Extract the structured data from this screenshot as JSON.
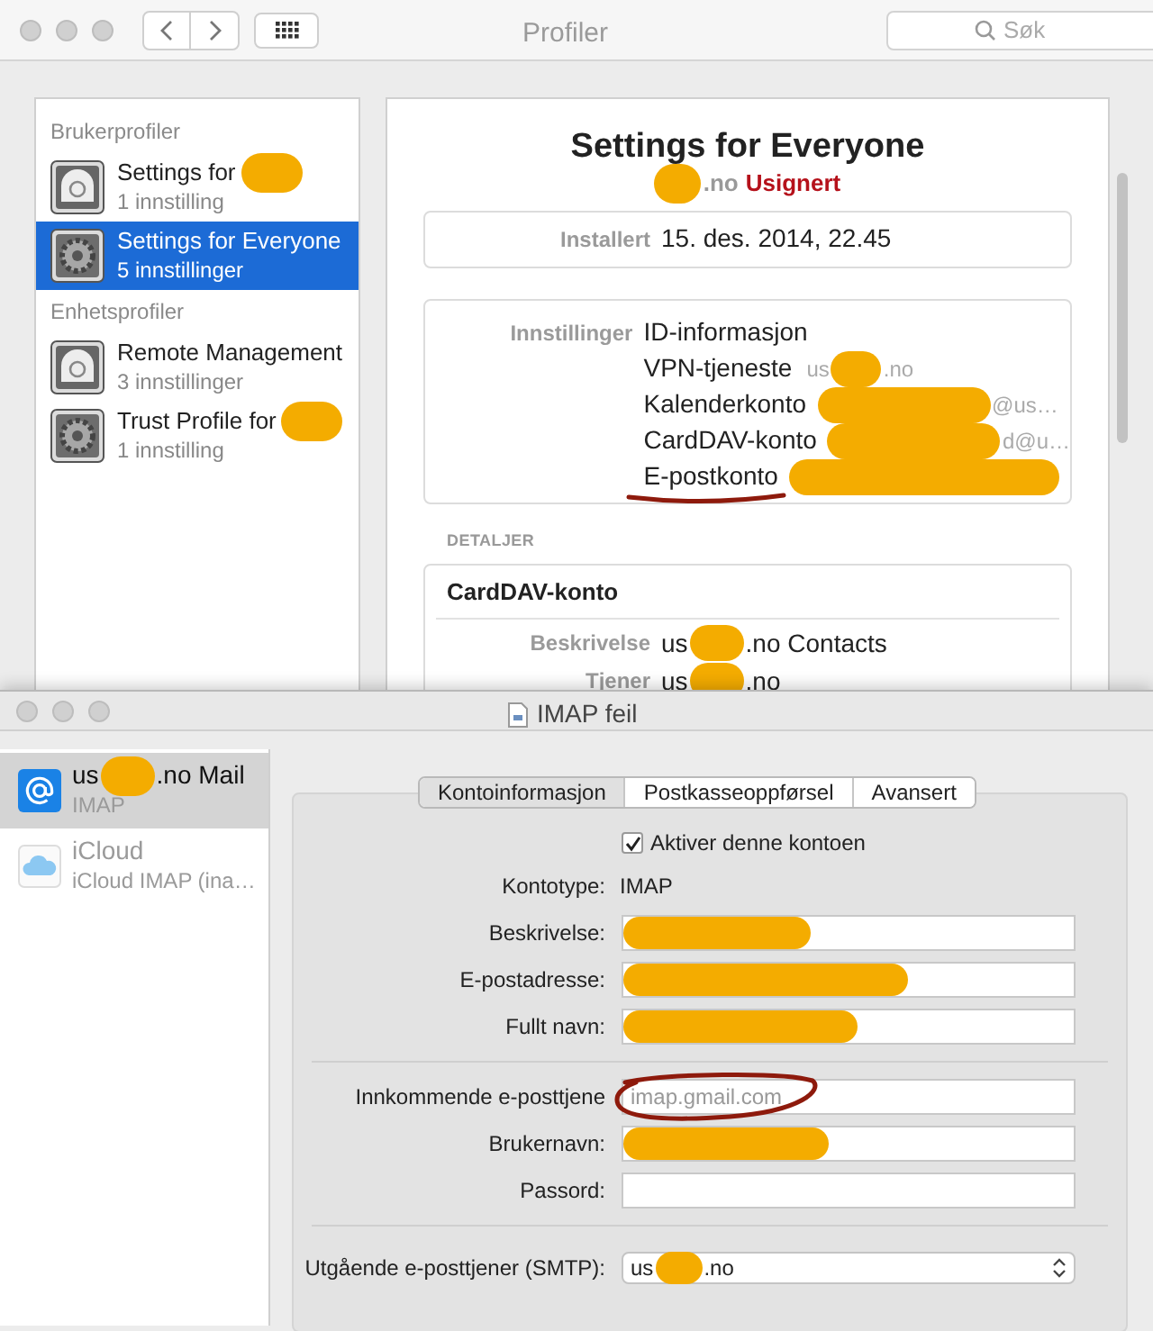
{
  "profiles_window": {
    "title": "Profiler",
    "search": {
      "placeholder": "Søk"
    },
    "sidebar": {
      "sections": [
        {
          "header": "Brukerprofiler",
          "items": [
            {
              "name": "Settings for",
              "redacted": true,
              "count": "1 innstilling",
              "selected": false,
              "kind": "badge"
            },
            {
              "name": "Settings for Everyone",
              "redacted": false,
              "count": "5 innstillinger",
              "selected": true,
              "kind": "gear"
            }
          ]
        },
        {
          "header": "Enhetsprofiler",
          "items": [
            {
              "name": "Remote Management",
              "redacted": false,
              "count": "3 innstillinger",
              "selected": false,
              "kind": "badge"
            },
            {
              "name": "Trust Profile for",
              "redacted": true,
              "count": "1 innstilling",
              "selected": false,
              "kind": "gear"
            }
          ]
        }
      ]
    },
    "detail": {
      "title": "Settings for Everyone",
      "org_after": ".no",
      "status": "Usignert",
      "installed": {
        "label": "Installert",
        "value": "15. des. 2014, 22.45"
      },
      "settings": {
        "label": "Innstillinger",
        "entries": [
          {
            "name": "ID-informasjon",
            "redacted": false,
            "marked": false
          },
          {
            "name": "VPN-tjeneste",
            "detail_before": "us",
            "detail_after": ".no",
            "redacted": true,
            "marked": false
          },
          {
            "name": "Kalenderkonto",
            "detail_after": "@us…",
            "redacted": true,
            "marked": false
          },
          {
            "name": "CardDAV-konto",
            "detail_after": "d@u…",
            "redacted": true,
            "marked": false
          },
          {
            "name": "E-postkonto",
            "redacted": true,
            "marked": true
          }
        ]
      },
      "details_header": "DETALJER",
      "card": {
        "title": "CardDAV-konto",
        "rows": [
          {
            "label": "Beskrivelse",
            "before": "us",
            "after": ".no Contacts"
          },
          {
            "label": "Tjener",
            "before": "us",
            "after": ".no"
          }
        ]
      }
    }
  },
  "mail_window": {
    "title": "IMAP feil",
    "accounts": [
      {
        "kind": "mail",
        "before": "us",
        "after": ".no Mail",
        "type": "IMAP",
        "selected": true,
        "disabled": false
      },
      {
        "kind": "icloud",
        "name": "iCloud",
        "type": "iCloud IMAP (ina…",
        "selected": false,
        "disabled": true
      }
    ],
    "tabs": [
      {
        "label": "Kontoinformasjon",
        "selected": true
      },
      {
        "label": "Postkasseoppførsel",
        "selected": false
      },
      {
        "label": "Avansert",
        "selected": false
      }
    ],
    "enable": {
      "label": "Aktiver denne kontoen",
      "checked": true
    },
    "account_type": {
      "label": "Kontotype:",
      "value": "IMAP"
    },
    "fields": [
      {
        "label": "Beskrivelse:",
        "redacted": true
      },
      {
        "label": "E-postadresse:",
        "redacted": true
      },
      {
        "label": "Fullt navn:",
        "redacted": true
      }
    ],
    "server_fields": [
      {
        "label": "Innkommende e-posttjene",
        "placeholder": "imap.gmail.com",
        "circled": true,
        "redacted": false
      },
      {
        "label": "Brukernavn:",
        "circled": false,
        "redacted": true
      },
      {
        "label": "Passord:",
        "circled": false,
        "redacted": false
      }
    ],
    "smtp": {
      "label": "Utgående e-posttjener (SMTP):",
      "before": "us",
      "after": ".no"
    }
  }
}
